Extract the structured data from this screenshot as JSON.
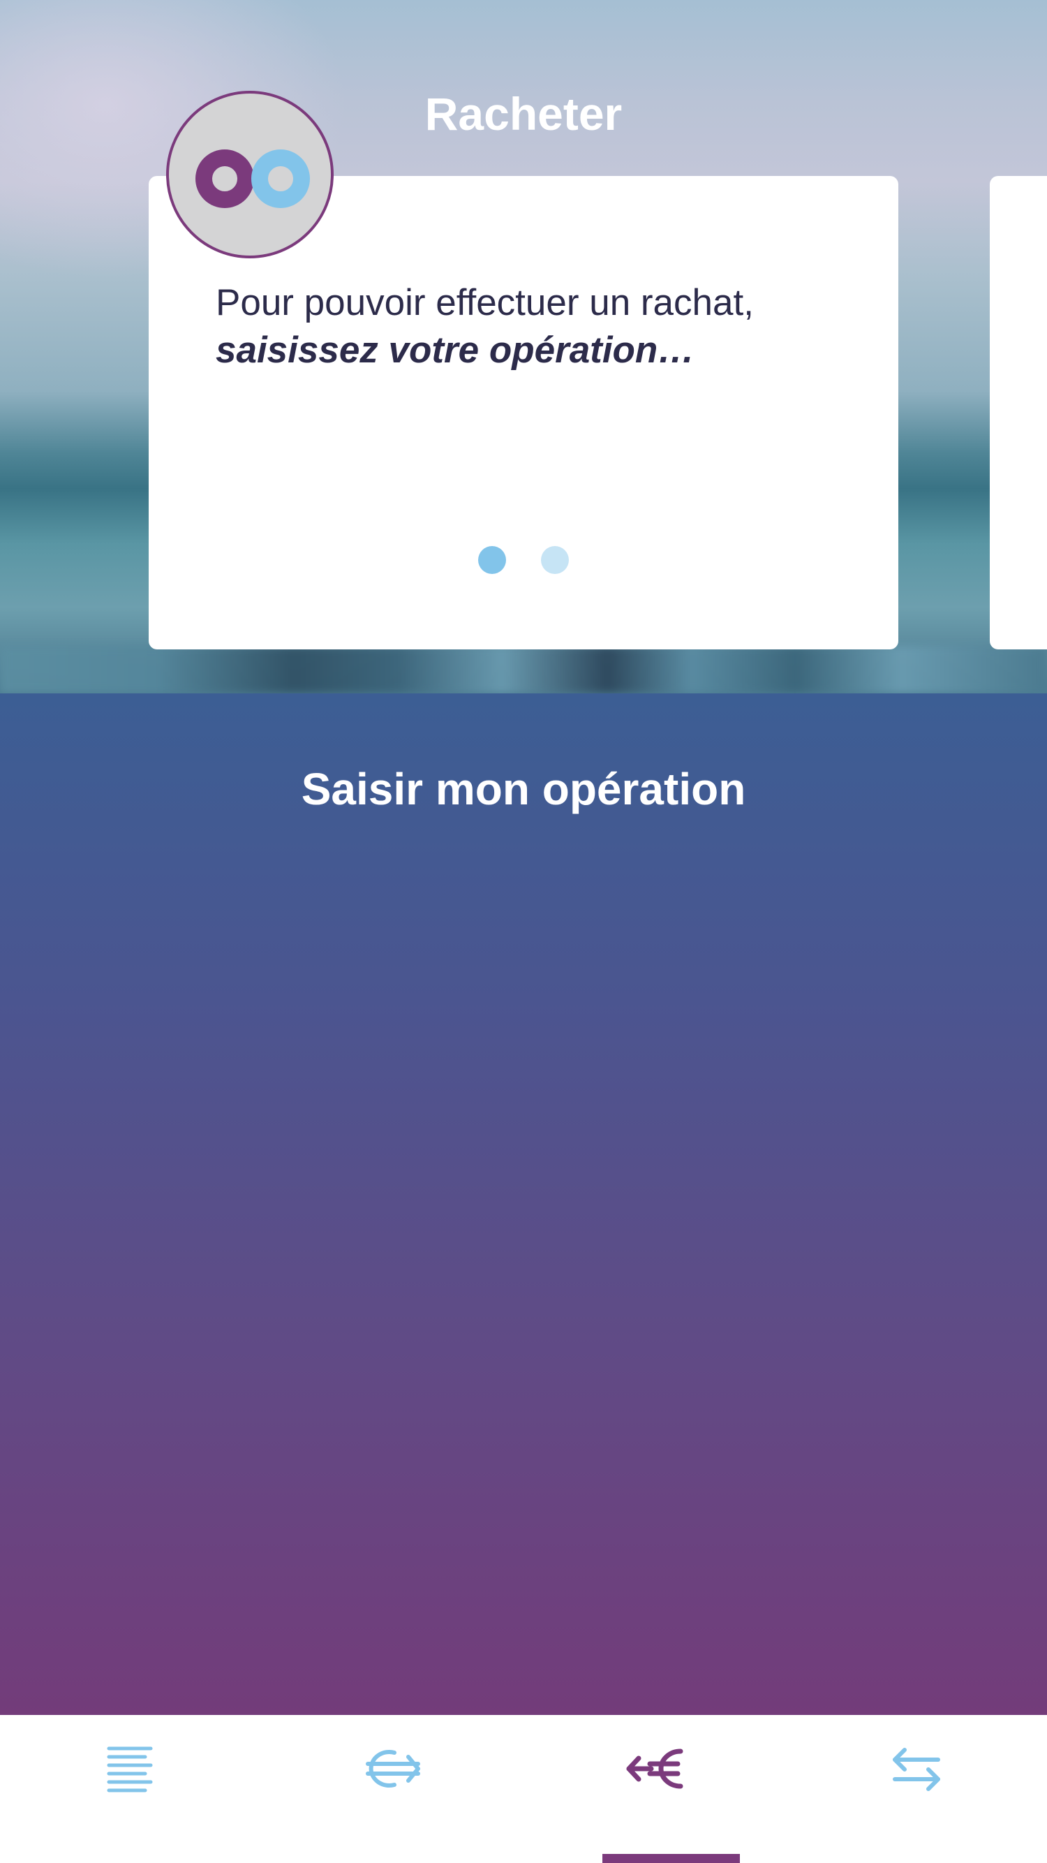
{
  "header": {
    "title": "Racheter"
  },
  "logo": {
    "icon": "oo-logo-icon",
    "colors": {
      "left_o": "#7b3a7c",
      "right_o": "#82c4ea",
      "background": "#d4d4d5",
      "border": "#7b3a7c"
    }
  },
  "card": {
    "text_line1": "Pour pouvoir effectuer un rachat,",
    "text_line2": "saisissez votre opération…",
    "pagination": {
      "current": 1,
      "total": 2
    }
  },
  "section": {
    "title": "Saisir mon opération"
  },
  "bottom_nav": {
    "items": [
      {
        "icon": "menu-lines-icon",
        "active": false
      },
      {
        "icon": "euro-right-arrow-icon",
        "active": false
      },
      {
        "icon": "left-arrow-euro-icon",
        "active": true
      },
      {
        "icon": "swap-arrows-icon",
        "active": false
      }
    ],
    "colors": {
      "active": "#7b3a7c",
      "inactive": "#82c4ea"
    }
  },
  "colors": {
    "text_dark": "#2c2b4a",
    "gradient_top": "#3c5e94",
    "gradient_bottom": "#733c7a",
    "dot_active": "#82c4ea",
    "dot_inactive": "#c6e4f5"
  }
}
